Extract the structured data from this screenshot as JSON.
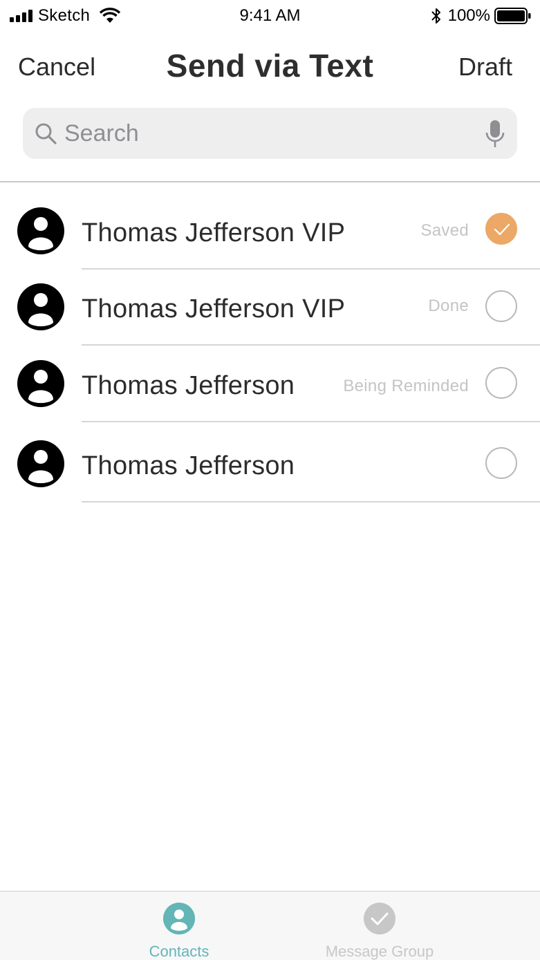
{
  "status_bar": {
    "carrier": "Sketch",
    "time": "9:41 AM",
    "battery": "100%"
  },
  "nav": {
    "cancel_label": "Cancel",
    "title": "Send via Text",
    "draft_label": "Draft"
  },
  "search": {
    "placeholder": "Search"
  },
  "contacts": [
    {
      "name": "Thomas Jefferson VIP",
      "status": "Saved",
      "selected": true
    },
    {
      "name": "Thomas Jefferson VIP",
      "status": "Done",
      "selected": false
    },
    {
      "name": "Thomas Jefferson",
      "status": "Being Reminded",
      "selected": false
    },
    {
      "name": "Thomas Jefferson",
      "status": "",
      "selected": false
    }
  ],
  "tabbar": {
    "tabs": [
      {
        "label": "Contacts",
        "active": true
      },
      {
        "label": "Message Group",
        "active": false
      }
    ]
  },
  "colors": {
    "accent_teal": "#63b5b6",
    "check_orange": "#eba866",
    "inactive_gray": "#c7c7c7"
  }
}
